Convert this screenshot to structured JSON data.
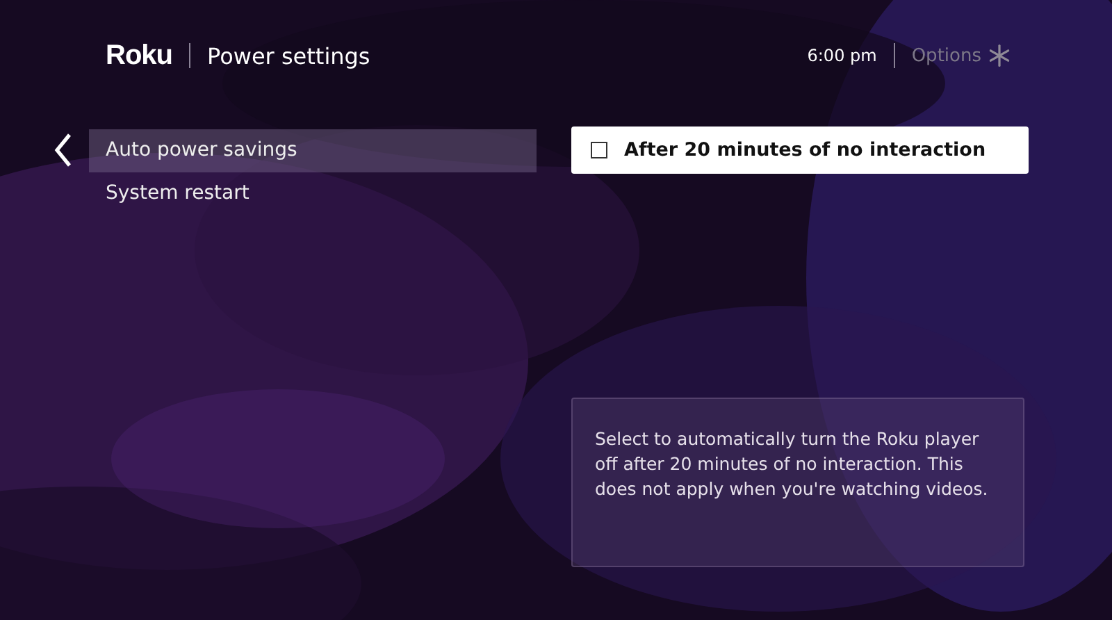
{
  "header": {
    "logo": "Roku",
    "title": "Power settings",
    "time": "6:00 pm",
    "options_label": "Options"
  },
  "menu": [
    {
      "label": "Auto power savings",
      "selected": true
    },
    {
      "label": "System restart",
      "selected": false
    }
  ],
  "option": {
    "label": "After 20 minutes of no interaction",
    "checked": false
  },
  "info": "Select to automatically turn the Roku player off after 20 minutes of no interaction. This does not apply when you're watching videos."
}
